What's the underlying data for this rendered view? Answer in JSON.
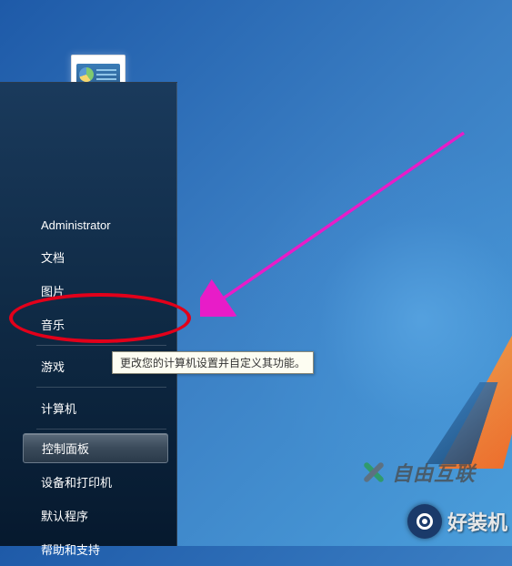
{
  "user": {
    "name": "Administrator"
  },
  "menu": {
    "items": [
      {
        "label": "文档",
        "sep_after": false
      },
      {
        "label": "图片",
        "sep_after": false
      },
      {
        "label": "音乐",
        "sep_after": true
      },
      {
        "label": "游戏",
        "sep_after": true
      },
      {
        "label": "计算机",
        "sep_after": true
      },
      {
        "label": "控制面板",
        "sep_after": false,
        "selected": true
      },
      {
        "label": "设备和打印机",
        "sep_after": false
      },
      {
        "label": "默认程序",
        "sep_after": false
      },
      {
        "label": "帮助和支持",
        "sep_after": false
      }
    ]
  },
  "tooltip": {
    "text": "更改您的计算机设置并自定义其功能。"
  },
  "watermarks": {
    "wm1": "自由互联",
    "wm2": "好装机"
  },
  "left_tab_glyph": "▶"
}
